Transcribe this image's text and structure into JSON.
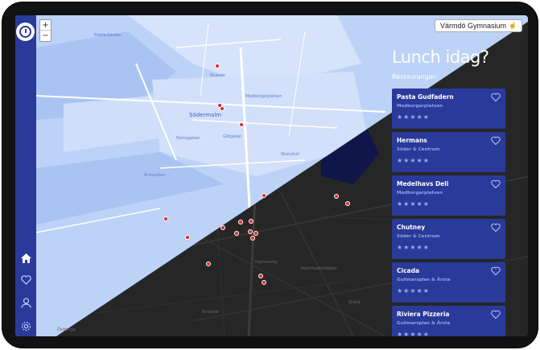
{
  "app": {
    "school_name": "Värmdö Gymnasium",
    "title": "Lunch idag?",
    "subtitle": "Restauranger:"
  },
  "map": {
    "zoom_in_label": "+",
    "zoom_out_label": "−",
    "district_label": "Södermalm",
    "labels_light": [
      "Riddarfjärden",
      "Slussen",
      "Medborgarplatsen",
      "Götgatan",
      "Skanstull",
      "Hornsgatan",
      "Årstaviken"
    ],
    "labels_dark": [
      "Hammarbyhöjden",
      "Enskede",
      "Östberga",
      "Sickla",
      "Hammarby"
    ]
  },
  "sidebar": {
    "items": [
      {
        "icon": "home-icon"
      },
      {
        "icon": "heart-icon"
      },
      {
        "icon": "user-icon"
      },
      {
        "icon": "gear-icon"
      }
    ]
  },
  "restaurants": [
    {
      "name": "Pasta Gudfadern",
      "area": "Medborgarplatsen",
      "stars": "★★★★★"
    },
    {
      "name": "Hermans",
      "area": "Söder & Centrum",
      "stars": "★★★★★"
    },
    {
      "name": "Medelhavs Deli",
      "area": "Medborgarplatsen",
      "stars": "★★★★★"
    },
    {
      "name": "Chutney",
      "area": "Söder & Centrum",
      "stars": "★★★★★"
    },
    {
      "name": "Cicada",
      "area": "Gullmarsplan & Årsta",
      "stars": "★★★★★"
    },
    {
      "name": "Riviera Pizzeria",
      "area": "Gullmarsplan & Årsta",
      "stars": "★★★★★"
    }
  ],
  "colors": {
    "accent": "#2a3a9a",
    "pin": "#e3262a",
    "map_light": "#bcd3f7",
    "map_dark": "#262626"
  }
}
